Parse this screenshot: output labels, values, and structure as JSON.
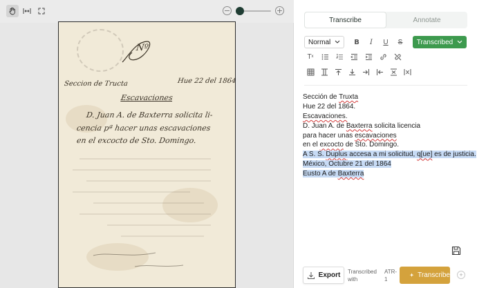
{
  "viewer": {
    "tools": [
      {
        "name": "hand-tool-icon",
        "active": true
      },
      {
        "name": "fit-width-icon",
        "active": false
      },
      {
        "name": "fullscreen-icon",
        "active": false
      }
    ],
    "zoom": {
      "minus": "−",
      "plus": "+",
      "level": 0.05
    },
    "manuscript_lines": [
      "Nº",
      "Seccion de Tructa",
      "Hue 22 del 1864.",
      "Escavaciones",
      "D. Juan A. de Baxterra solicita li-",
      "cencia pª hacer unas escavaciones",
      "en el excocto de Sto. Domingo."
    ]
  },
  "panel": {
    "tabs": [
      {
        "label": "Transcribe",
        "active": true
      },
      {
        "label": "Annotate",
        "active": false
      }
    ],
    "toolbar": {
      "format_select": "Normal",
      "status_label": "Transcribed",
      "row1_icons": [
        "bold-icon",
        "italic-icon",
        "underline-icon",
        "strikethrough-icon"
      ],
      "row2_icons": [
        "superscript-icon",
        "bullet-list-icon",
        "numbered-list-icon",
        "outdent-icon",
        "indent-icon",
        "link-icon",
        "unlink-icon"
      ],
      "row3_icons": [
        "table-icon",
        "insert-column-left-icon",
        "insert-row-above-icon",
        "insert-row-below-icon",
        "insert-column-right-icon",
        "insert-row-before-icon",
        "delete-row-icon",
        "delete-column-icon"
      ]
    },
    "transcription": [
      {
        "segments": [
          {
            "t": "Sección de "
          },
          {
            "t": "Truxta",
            "spell": true
          }
        ]
      },
      {
        "segments": [
          {
            "t": "Hue 22 del 1864."
          }
        ]
      },
      {
        "segments": [
          {
            "t": "Escavaciones.",
            "spell": true
          }
        ]
      },
      {
        "segments": [
          {
            "t": "D. Juan A. de "
          },
          {
            "t": "Baxterra",
            "spell": true
          },
          {
            "t": " solicita licencia"
          }
        ]
      },
      {
        "segments": [
          {
            "t": "para hacer unas "
          },
          {
            "t": "escavaciones",
            "spell": true
          }
        ]
      },
      {
        "segments": [
          {
            "t": "en el "
          },
          {
            "t": "excocto",
            "spell": true
          },
          {
            "t": " de Sto. Domingo."
          }
        ]
      },
      {
        "highlight": true,
        "segments": [
          {
            "t": "A S. S. "
          },
          {
            "t": "Duplus",
            "spell": true
          },
          {
            "t": " accesa a mi solicitud, "
          },
          {
            "t": "q[ue]",
            "spell": true
          },
          {
            "t": " es de justicia."
          }
        ]
      },
      {
        "highlight": true,
        "segments": [
          {
            "t": "México, Octubre 21 del 1864"
          }
        ]
      },
      {
        "highlight": true,
        "segments": [
          {
            "t": "Eusto A de "
          },
          {
            "t": "Baxterra",
            "spell": true
          }
        ]
      }
    ],
    "bottom": {
      "export_label": "Export",
      "transcribed_with_line1": "Transcribed",
      "transcribed_with_line2": "with",
      "model_line1": "ATR-",
      "model_line2": "1",
      "transcribe_label": "Transcribe"
    },
    "colors": {
      "status_green": "#3d9a4e",
      "transcribe_gold": "#d4a23c",
      "highlight": "#c7dbf5"
    }
  }
}
